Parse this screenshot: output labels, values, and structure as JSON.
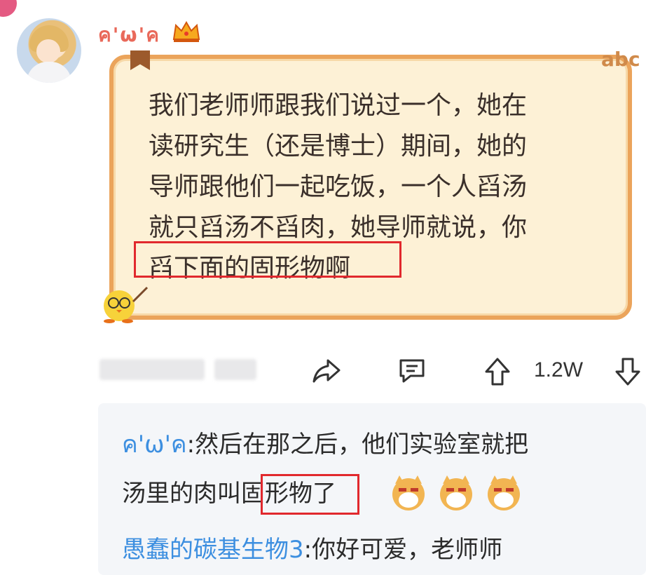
{
  "post": {
    "username": "ค'ω'ค",
    "note_sticker_text": "abc",
    "note_lines": [
      "我们老师师跟我们说过一个，她在",
      "读研究生（还是博士）期间，她的",
      "导师跟他们一起吃饭，一个人舀汤",
      "就只舀汤不舀肉，她导师就说，你",
      "舀下面的固形物啊"
    ]
  },
  "actions": {
    "vote_count": "1.2W"
  },
  "comments": [
    {
      "user": "ค'ω'ค",
      "sep": ":",
      "text_line1": "然后在那之后，他们实验室就把",
      "text_line2_pre": "汤里的肉叫",
      "text_line2_highlight": "固形物",
      "text_line2_post": "了"
    },
    {
      "user": "愚蠢的碳基生物3",
      "sep": ":",
      "text": "你好可爱，老师师"
    }
  ],
  "colors": {
    "accent_red": "#e1282d",
    "username_orange": "#e9695a",
    "comment_user_blue": "#3d8fe0",
    "note_border": "#eba45b"
  },
  "icons": [
    "crown-icon",
    "share-icon",
    "comment-icon",
    "upvote-icon",
    "downvote-icon",
    "doge-emoji"
  ]
}
